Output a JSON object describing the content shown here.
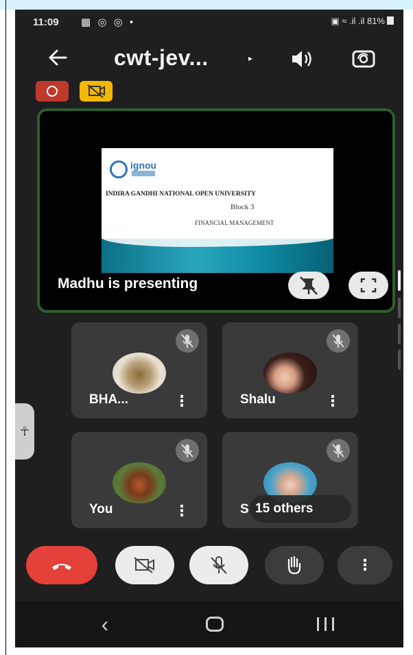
{
  "status_bar": {
    "time": "11:09",
    "notification_icons": "▩ ◎ ◎ •",
    "right_icons": "▣ ≈ .il .il",
    "battery": "81%"
  },
  "toolbar": {
    "title": "cwt-jev...",
    "title_caret": "▸"
  },
  "presentation": {
    "presenter_label": "Madhu is presenting",
    "slide": {
      "logo_text": "ignou",
      "university": "INDIRA GANDHI NATIONAL OPEN UNIVERSITY",
      "block": "Block 3",
      "subject": "FINANCIAL MANAGEMENT"
    }
  },
  "participants": [
    {
      "name": "BHA...",
      "menu": "⋮"
    },
    {
      "name": "Shalu",
      "menu": "⋮"
    },
    {
      "name": "You",
      "menu": "⋮"
    },
    {
      "name": "S",
      "others_label": "15 others"
    }
  ],
  "accessibility_tab": {
    "glyph": "☥"
  },
  "controls": {
    "more_glyph": "⋮"
  },
  "nav": {
    "back_glyph": "‹"
  },
  "colors": {
    "end_call": "#e5413b",
    "record_badge": "#c0392b",
    "camera_badge": "#f5b800",
    "present_border": "#2f5e2f"
  },
  "icons": [
    "back-arrow-icon",
    "speaker-icon",
    "switch-camera-icon",
    "record-icon",
    "camera-off-badge-icon",
    "unpin-icon",
    "fullscreen-icon",
    "mic-off-icon",
    "more-vert-icon",
    "end-call-icon",
    "camera-off-icon",
    "raise-hand-icon",
    "accessibility-icon",
    "nav-back-icon",
    "nav-home-icon",
    "nav-recents-icon"
  ]
}
